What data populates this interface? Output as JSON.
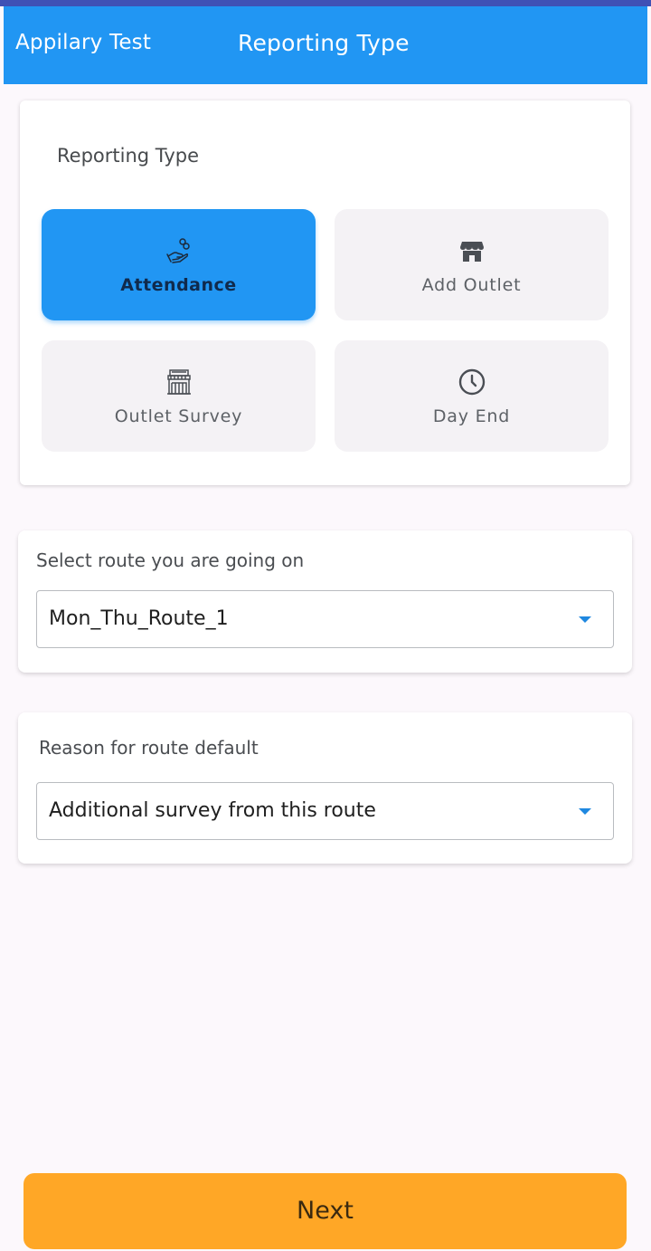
{
  "app_bar": {
    "app_name": "Appilary Test",
    "title": "Reporting Type",
    "color": "#2196f3"
  },
  "reporting_card": {
    "title": "Reporting Type",
    "tiles": [
      {
        "label": "Attendance",
        "icon": "hand-coins-icon",
        "selected": true
      },
      {
        "label": "Add Outlet",
        "icon": "storefront-icon",
        "selected": false
      },
      {
        "label": "Outlet Survey",
        "icon": "shop-building-icon",
        "selected": false
      },
      {
        "label": "Day End",
        "icon": "clock-icon",
        "selected": false
      }
    ]
  },
  "route_card": {
    "label": "Select route you are going on",
    "selected_value": "Mon_Thu_Route_1"
  },
  "reason_card": {
    "label": "Reason for route default",
    "selected_value": "Additional survey from this route"
  },
  "footer": {
    "next_label": "Next",
    "color": "#ffa726"
  }
}
